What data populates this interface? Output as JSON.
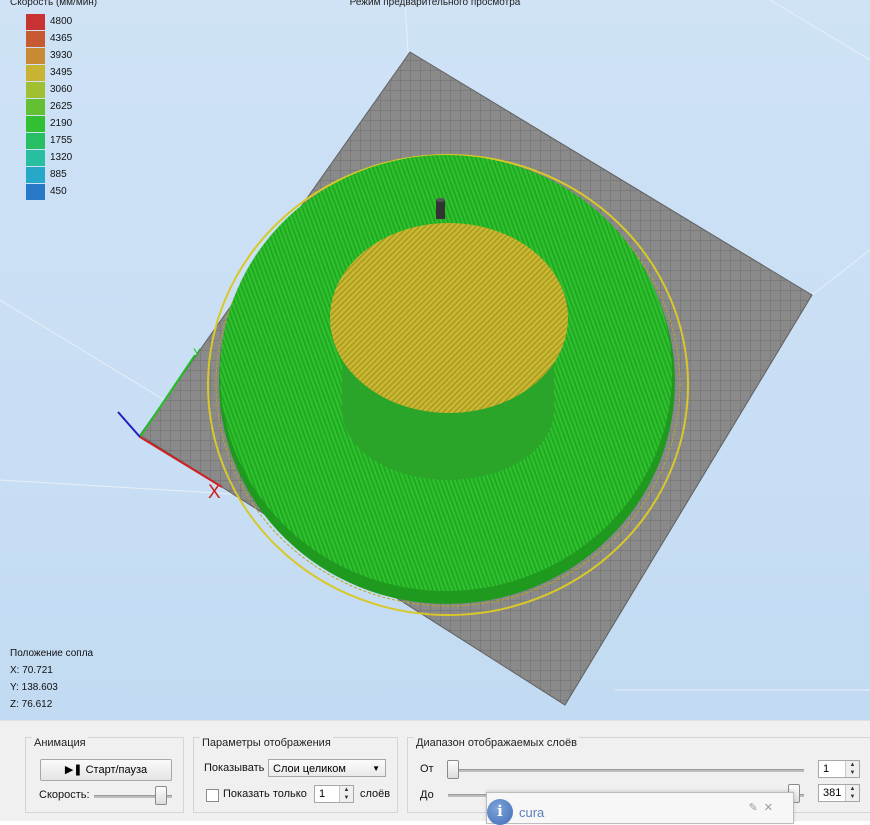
{
  "viewport": {
    "title": "Режим предварительного просмотра",
    "legend": {
      "title": "Скорость (мм/мин)",
      "items": [
        {
          "value": "4800",
          "color": "#c83232"
        },
        {
          "value": "4365",
          "color": "#c85a32"
        },
        {
          "value": "3930",
          "color": "#c88a32"
        },
        {
          "value": "3495",
          "color": "#c8b432"
        },
        {
          "value": "3060",
          "color": "#a0c032"
        },
        {
          "value": "2625",
          "color": "#64c032"
        },
        {
          "value": "2190",
          "color": "#32c032"
        },
        {
          "value": "1755",
          "color": "#28be64"
        },
        {
          "value": "1320",
          "color": "#28bea0"
        },
        {
          "value": "885",
          "color": "#28a8c8"
        },
        {
          "value": "450",
          "color": "#2878c8"
        }
      ]
    },
    "axis_labels": {
      "x": "X",
      "y": "Y"
    },
    "nozzle": {
      "title": "Положение сопла",
      "x": "X: 70.721",
      "y": "Y: 138.603",
      "z": "Z: 76.612"
    }
  },
  "animation": {
    "title": "Анимация",
    "play_label": "Старт/пауза",
    "speed_label": "Скорость:"
  },
  "display": {
    "title": "Параметры отображения",
    "show_label": "Показывать",
    "show_value": "Слои целиком",
    "only_label": "Показать только",
    "only_value": "1",
    "layers_label": "слоёв"
  },
  "range": {
    "title": "Диапазон отображаемых слоёв",
    "from_label": "От",
    "from_value": "1",
    "to_label": "До",
    "to_value": "381"
  },
  "popup": {
    "app_name": "cura",
    "icon": "info-icon"
  }
}
